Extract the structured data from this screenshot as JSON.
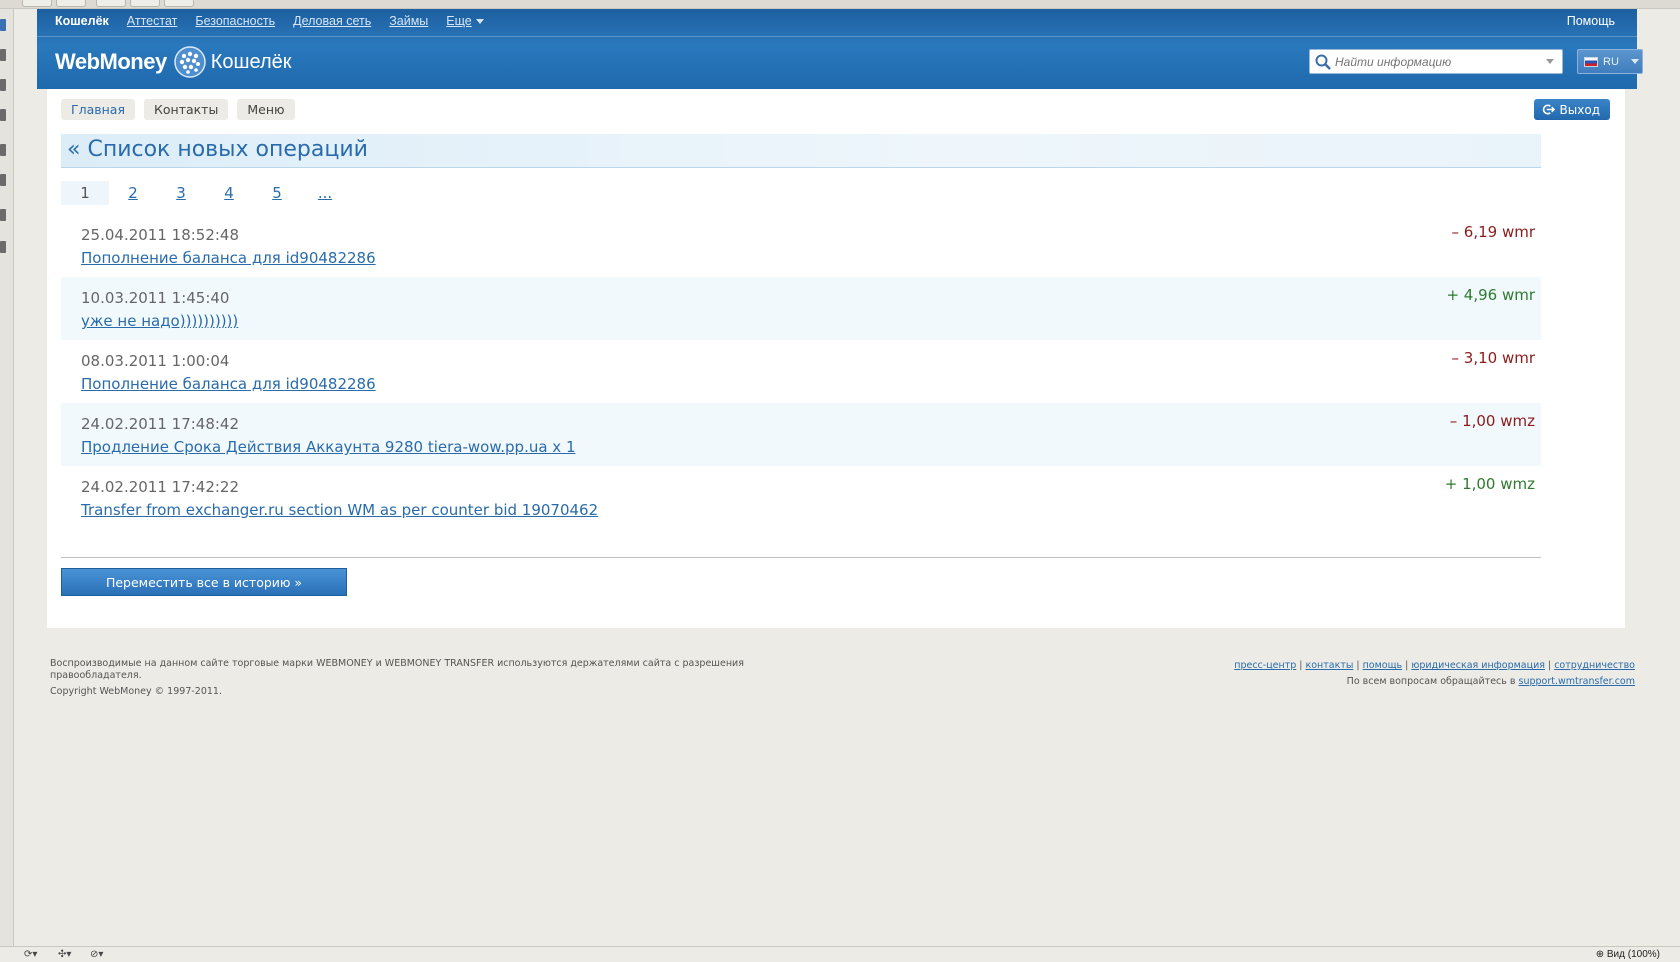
{
  "topnav": {
    "items": [
      "Кошелёк",
      "Аттестат",
      "Безопасность",
      "Деловая сеть",
      "Займы",
      "Еще"
    ],
    "help": "Помощь"
  },
  "logo": {
    "brand": "WebMoney",
    "product": "Кошелёк"
  },
  "search": {
    "placeholder": "Найти информацию"
  },
  "lang": {
    "code": "RU"
  },
  "subnav": {
    "home": "Главная",
    "contacts": "Контакты",
    "menu": "Меню",
    "logout": "Выход"
  },
  "page_title": "« Список новых операций",
  "pager": [
    "1",
    "2",
    "3",
    "4",
    "5",
    "..."
  ],
  "operations": [
    {
      "date": "25.04.2011 18:52:48",
      "description": "Пополнение баланса для id90482286",
      "amount": "– 6,19 wmr",
      "direction": "out"
    },
    {
      "date": "10.03.2011 1:45:40",
      "description": "уже не надо))))))))))",
      "amount": "+ 4,96 wmr",
      "direction": "in"
    },
    {
      "date": "08.03.2011 1:00:04",
      "description": "Пополнение баланса для id90482286",
      "amount": "– 3,10 wmr",
      "direction": "out"
    },
    {
      "date": "24.02.2011 17:48:42",
      "description": "Продление Срока Действия Аккаунта 9280 tiera-wow.pp.ua x 1",
      "amount": "– 1,00 wmz",
      "direction": "out"
    },
    {
      "date": "24.02.2011 17:42:22",
      "description": "Transfer from exchanger.ru section WM as per counter bid 19070462",
      "amount": "+ 1,00 wmz",
      "direction": "in"
    }
  ],
  "move_button": "Переместить все в историю »",
  "footer": {
    "notice": "Воспроизводимые на данном сайте торговые марки WEBMONEY и WEBMONEY TRANSFER используются держателями сайта с разрешения правообладателя.",
    "copyright": "Copyright WebMoney © 1997-2011.",
    "links": [
      "пресс-центр",
      "контакты",
      "помощь",
      "юридическая информация",
      "сотрудничество"
    ],
    "contact_text": "По всем вопросам обращайтесь в",
    "contact_link": "support.wmtransfer.com"
  },
  "status_bar": {
    "zoom": "Вид (100%)"
  },
  "colors": {
    "header_blue": "#2a78bd",
    "link": "#2a6cab",
    "negative": "#8b1c1c",
    "positive": "#2f7a2f"
  }
}
